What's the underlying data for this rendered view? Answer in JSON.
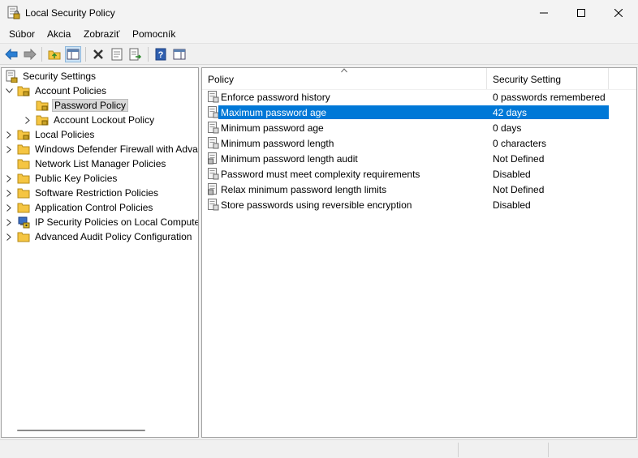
{
  "window": {
    "title": "Local Security Policy",
    "icon": "security-policy-icon"
  },
  "menu": [
    "Súbor",
    "Akcia",
    "Zobraziť",
    "Pomocník"
  ],
  "toolbar": {
    "buttons": [
      "back-arrow-icon",
      "forward-arrow-icon",
      "up-folder-icon",
      "show-hide-tree-icon",
      "delete-icon",
      "properties-icon",
      "export-list-icon",
      "help-icon",
      "show-hide-action-pane-icon"
    ],
    "active": "show-hide-tree-icon"
  },
  "tree": {
    "root": "Security Settings",
    "items": [
      {
        "label": "Account Policies",
        "expanded": true
      },
      {
        "label": "Password Policy",
        "selected": true
      },
      {
        "label": "Account Lockout Policy"
      },
      {
        "label": "Local Policies"
      },
      {
        "label": "Windows Defender Firewall with Adva"
      },
      {
        "label": "Network List Manager Policies"
      },
      {
        "label": "Public Key Policies"
      },
      {
        "label": "Software Restriction Policies"
      },
      {
        "label": "Application Control Policies"
      },
      {
        "label": "IP Security Policies on Local Compute"
      },
      {
        "label": "Advanced Audit Policy Configuration"
      }
    ]
  },
  "list": {
    "columns": [
      "Policy",
      "Security Setting"
    ],
    "rows": [
      {
        "policy": "Enforce password history",
        "setting": "0 passwords remembered"
      },
      {
        "policy": "Maximum password age",
        "setting": "42 days",
        "selected": true
      },
      {
        "policy": "Minimum password age",
        "setting": "0 days"
      },
      {
        "policy": "Minimum password length",
        "setting": "0 characters"
      },
      {
        "policy": "Minimum password length audit",
        "setting": "Not Defined"
      },
      {
        "policy": "Password must meet complexity requirements",
        "setting": "Disabled"
      },
      {
        "policy": "Relax minimum password length limits",
        "setting": "Not Defined"
      },
      {
        "policy": "Store passwords using reversible encryption",
        "setting": "Disabled"
      }
    ]
  },
  "colors": {
    "selection": "#0078d7",
    "folder": "#f5c542"
  }
}
